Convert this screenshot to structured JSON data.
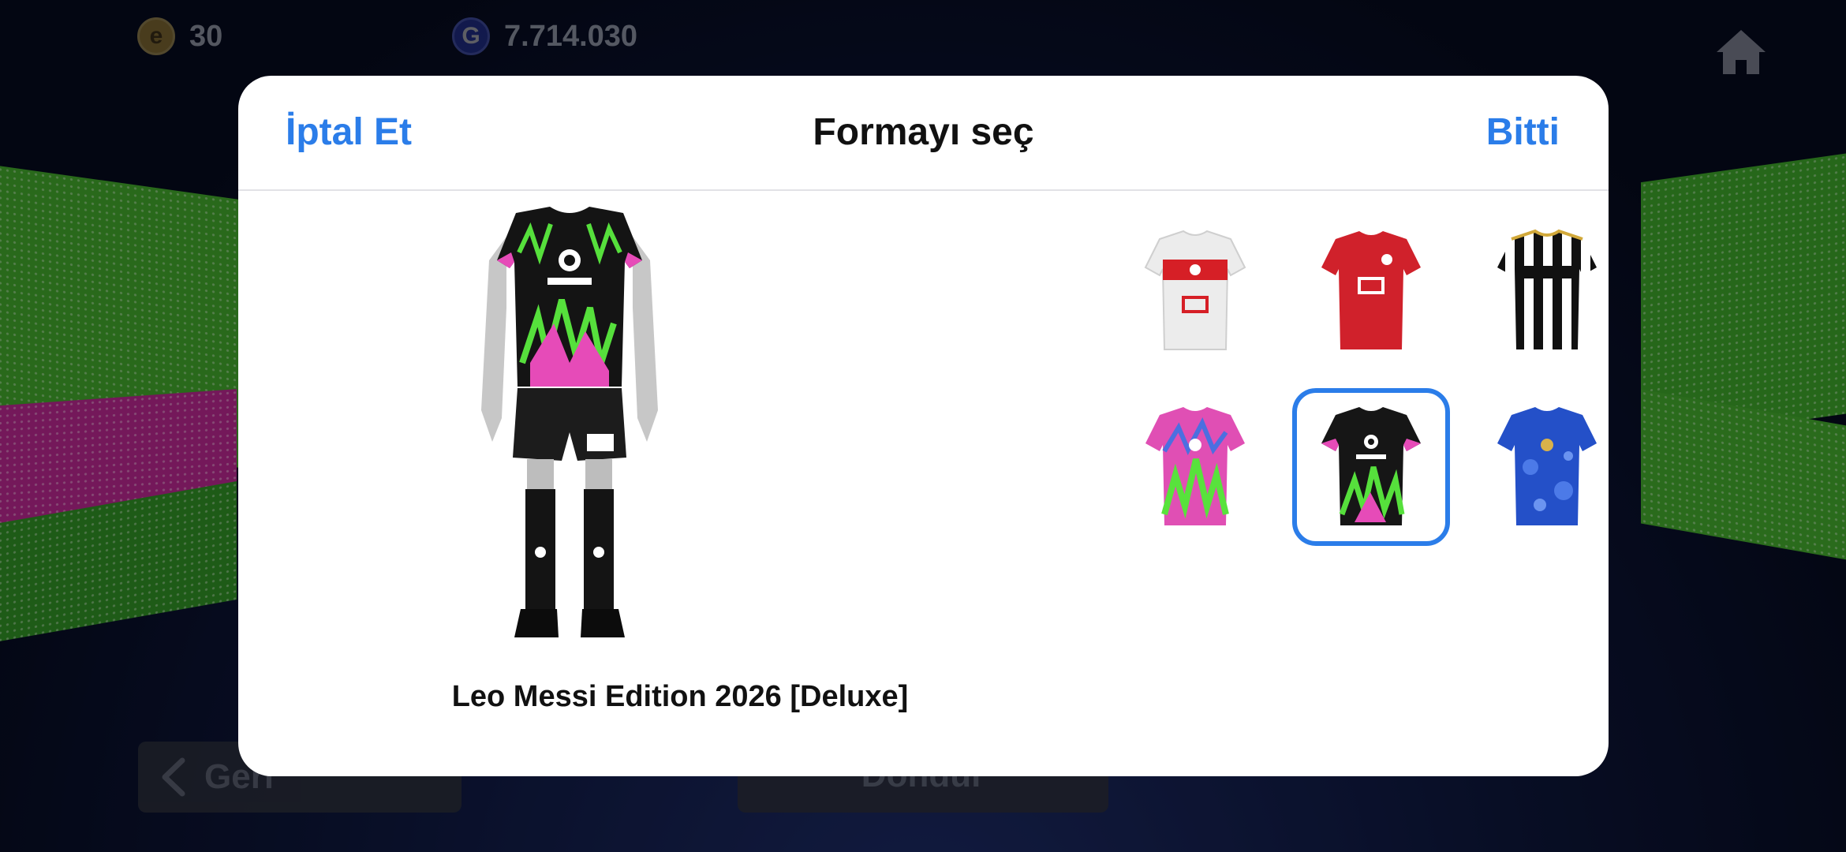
{
  "hud": {
    "ecoin_value": "30",
    "gp_value": "7.714.030",
    "ecoin_symbol": "e",
    "gp_symbol": "G"
  },
  "background": {
    "back_label": "Geri",
    "rotate_label": "Döndür"
  },
  "modal": {
    "cancel_label": "İptal Et",
    "title": "Formayı seç",
    "done_label": "Bitti",
    "selected_kit_name": "Leo Messi Edition 2026 [Deluxe]",
    "kits": [
      {
        "id": "turkey-away",
        "selected": false
      },
      {
        "id": "turkey-home",
        "selected": false
      },
      {
        "id": "black-white-stripes",
        "selected": false
      },
      {
        "id": "green-pink-floral",
        "selected": false
      },
      {
        "id": "messi-pink-green",
        "selected": false
      },
      {
        "id": "messi-black",
        "selected": true
      },
      {
        "id": "blue-pattern",
        "selected": false
      }
    ]
  },
  "colors": {
    "accent": "#2b7de9",
    "modal_bg": "#ffffff",
    "title_text": "#111111"
  },
  "icons": {
    "ecoin": "ecoin-icon",
    "gp": "gp-coin-icon",
    "home": "home-icon",
    "back": "chevron-left-icon"
  }
}
